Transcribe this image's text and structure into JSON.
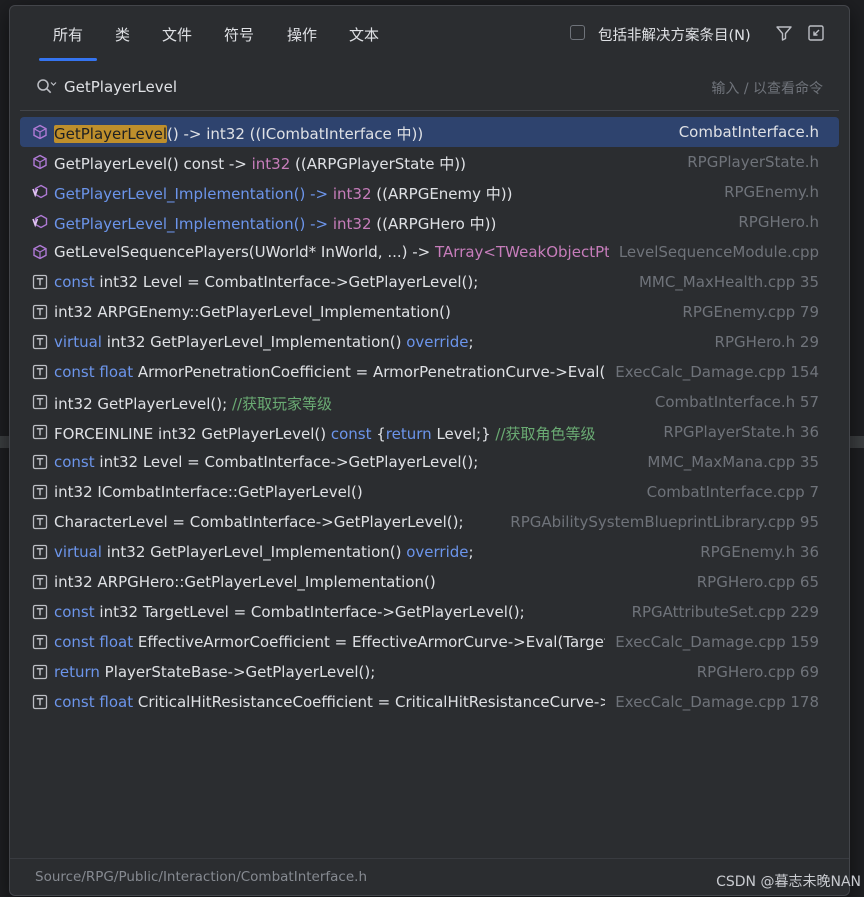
{
  "tabs": [
    {
      "label": "所有",
      "active": true
    },
    {
      "label": "类",
      "active": false
    },
    {
      "label": "文件",
      "active": false
    },
    {
      "label": "符号",
      "active": false
    },
    {
      "label": "操作",
      "active": false
    },
    {
      "label": "文本",
      "active": false
    }
  ],
  "option_label": "包括非解决方案条目(N)",
  "option_checked": false,
  "search": {
    "value": "GetPlayerLevel",
    "hint": "输入 / 以查看命令"
  },
  "colors": {
    "accent": "#3574f0",
    "selection": "#2e436e",
    "highlight": "#bf8f2c",
    "keyword": "#6c95eb",
    "comment": "#6aab73",
    "purple": "#c77dbb"
  },
  "results": [
    {
      "icon": "method-icon",
      "selected": true,
      "segments": [
        {
          "t": "GetPlayerLevel",
          "s": "hl"
        },
        {
          "t": "() -> int32 ((ICombatInterface 中))",
          "s": ""
        }
      ],
      "location": "CombatInterface.h"
    },
    {
      "icon": "method-icon",
      "segments": [
        {
          "t": "GetPlayerLevel() const -> ",
          "s": ""
        },
        {
          "t": "int32",
          "s": "pk"
        },
        {
          "t": " ((ARPGPlayerState 中))",
          "s": ""
        }
      ],
      "location": "RPGPlayerState.h"
    },
    {
      "icon": "virtual-method-icon",
      "segments": [
        {
          "t": "GetPlayerLevel_Implementation() -> ",
          "s": "kw"
        },
        {
          "t": "int32",
          "s": "pk"
        },
        {
          "t": " ((ARPGEnemy 中))",
          "s": ""
        }
      ],
      "location": "RPGEnemy.h"
    },
    {
      "icon": "virtual-method-icon",
      "segments": [
        {
          "t": "GetPlayerLevel_Implementation() -> ",
          "s": "kw"
        },
        {
          "t": "int32",
          "s": "pk"
        },
        {
          "t": " ((ARPGHero 中))",
          "s": ""
        }
      ],
      "location": "RPGHero.h"
    },
    {
      "icon": "method-icon",
      "segments": [
        {
          "t": "GetLevelSequencePlayers(UWorld* InWorld, ...) -> ",
          "s": ""
        },
        {
          "t": "TArray<TWeakObjectPtr<",
          "s": "pk"
        }
      ],
      "location": "LevelSequenceModule.cpp"
    },
    {
      "icon": "text-icon",
      "segments": [
        {
          "t": "const",
          "s": "kw"
        },
        {
          "t": " int32 Level = CombatInterface->GetPlayerLevel();",
          "s": ""
        }
      ],
      "location": "MMC_MaxHealth.cpp 35"
    },
    {
      "icon": "text-icon",
      "segments": [
        {
          "t": "int32 ARPGEnemy::GetPlayerLevel_Implementation()",
          "s": ""
        }
      ],
      "location": "RPGEnemy.cpp 79"
    },
    {
      "icon": "text-icon",
      "segments": [
        {
          "t": "virtual",
          "s": "kw"
        },
        {
          "t": " int32 GetPlayerLevel_Implementation() ",
          "s": ""
        },
        {
          "t": "override",
          "s": "kw"
        },
        {
          "t": ";",
          "s": ""
        }
      ],
      "location": "RPGHero.h 29"
    },
    {
      "icon": "text-icon",
      "segments": [
        {
          "t": "const float",
          "s": "kw"
        },
        {
          "t": " ArmorPenetrationCoefficient = ArmorPenetrationCurve->Eval(Sou",
          "s": ""
        }
      ],
      "location": "ExecCalc_Damage.cpp 154"
    },
    {
      "icon": "text-icon",
      "segments": [
        {
          "t": "int32 GetPlayerLevel(); ",
          "s": ""
        },
        {
          "t": "//获取玩家等级",
          "s": "cm"
        }
      ],
      "location": "CombatInterface.h 57"
    },
    {
      "icon": "text-icon",
      "segments": [
        {
          "t": "FORCEINLINE int32 GetPlayerLevel() ",
          "s": ""
        },
        {
          "t": "const",
          "s": "kw"
        },
        {
          "t": " {",
          "s": ""
        },
        {
          "t": "return",
          "s": "kw"
        },
        {
          "t": " Level;} ",
          "s": ""
        },
        {
          "t": "//获取角色等级",
          "s": "cm"
        }
      ],
      "location": "RPGPlayerState.h 36"
    },
    {
      "icon": "text-icon",
      "segments": [
        {
          "t": "const",
          "s": "kw"
        },
        {
          "t": " int32 Level = CombatInterface->GetPlayerLevel();",
          "s": ""
        }
      ],
      "location": "MMC_MaxMana.cpp 35"
    },
    {
      "icon": "text-icon",
      "segments": [
        {
          "t": "int32 ICombatInterface::GetPlayerLevel()",
          "s": ""
        }
      ],
      "location": "CombatInterface.cpp 7"
    },
    {
      "icon": "text-icon",
      "segments": [
        {
          "t": "CharacterLevel = CombatInterface->GetPlayerLevel();",
          "s": ""
        }
      ],
      "location": "RPGAbilitySystemBlueprintLibrary.cpp 95"
    },
    {
      "icon": "text-icon",
      "segments": [
        {
          "t": "virtual",
          "s": "kw"
        },
        {
          "t": " int32 GetPlayerLevel_Implementation() ",
          "s": ""
        },
        {
          "t": "override",
          "s": "kw"
        },
        {
          "t": ";",
          "s": ""
        }
      ],
      "location": "RPGEnemy.h 36"
    },
    {
      "icon": "text-icon",
      "segments": [
        {
          "t": "int32 ARPGHero::GetPlayerLevel_Implementation()",
          "s": ""
        }
      ],
      "location": "RPGHero.cpp 65"
    },
    {
      "icon": "text-icon",
      "segments": [
        {
          "t": "const",
          "s": "kw"
        },
        {
          "t": " int32 TargetLevel = CombatInterface->GetPlayerLevel();",
          "s": ""
        }
      ],
      "location": "RPGAttributeSet.cpp 229"
    },
    {
      "icon": "text-icon",
      "segments": [
        {
          "t": "const float",
          "s": "kw"
        },
        {
          "t": " EffectiveArmorCoefficient = EffectiveArmorCurve->Eval(TargetCor",
          "s": ""
        }
      ],
      "location": "ExecCalc_Damage.cpp 159"
    },
    {
      "icon": "text-icon",
      "segments": [
        {
          "t": "return",
          "s": "kw"
        },
        {
          "t": " PlayerStateBase->GetPlayerLevel();",
          "s": ""
        }
      ],
      "location": "RPGHero.cpp 69"
    },
    {
      "icon": "text-icon",
      "segments": [
        {
          "t": "const float",
          "s": "kw"
        },
        {
          "t": " CriticalHitResistanceCoefficient = CriticalHitResistanceCurve->Eval",
          "s": ""
        }
      ],
      "location": "ExecCalc_Damage.cpp 178"
    }
  ],
  "footer_path": "Source/RPG/Public/Interaction/CombatInterface.h",
  "watermark": "CSDN @暮志未晚NAN"
}
